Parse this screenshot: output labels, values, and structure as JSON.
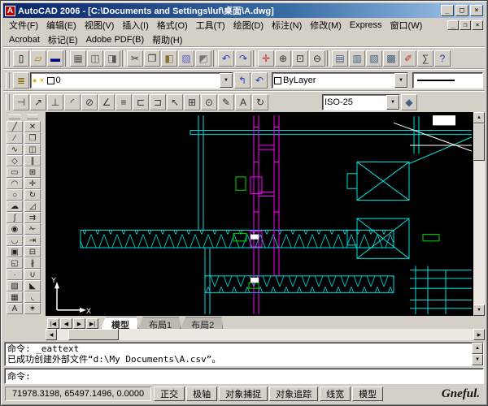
{
  "window": {
    "title": "AutoCAD 2006 - [C:\\Documents and Settings\\luf\\桌面\\A.dwg]",
    "icon_letter": "A"
  },
  "window_controls": {
    "minimize": "_",
    "maximize": "□",
    "restore": "❐",
    "close": "×"
  },
  "glyphs": {
    "combo_arrow": "▼",
    "up": "▲",
    "down": "▼",
    "left": "◀",
    "right": "▶"
  },
  "menubar": {
    "items": [
      "文件(F)",
      "编辑(E)",
      "视图(V)",
      "插入(I)",
      "格式(O)",
      "工具(T)",
      "绘图(D)",
      "标注(N)",
      "修改(M)",
      "Express",
      "窗口(W)"
    ]
  },
  "menubar2": {
    "items": [
      "Acrobat",
      "标记(E)",
      "Adobe PDF(B)",
      "帮助(H)"
    ]
  },
  "toolbar_standard": {
    "icons": [
      {
        "name": "qnew-icon",
        "glyph": "▯",
        "color": "#000000"
      },
      {
        "name": "open-icon",
        "glyph": "▱",
        "color": "#b08000"
      },
      {
        "name": "save-icon",
        "glyph": "▬",
        "color": "#000080"
      },
      {
        "sep": true
      },
      {
        "name": "plot-icon",
        "glyph": "▦",
        "color": "#555555"
      },
      {
        "name": "plot-preview-icon",
        "glyph": "◫",
        "color": "#555555"
      },
      {
        "name": "publish-icon",
        "glyph": "◨",
        "color": "#555555"
      },
      {
        "sep": true
      },
      {
        "name": "cut-icon",
        "glyph": "✂",
        "color": "#333333"
      },
      {
        "name": "copy-icon",
        "glyph": "❐",
        "color": "#333333"
      },
      {
        "name": "paste-icon",
        "glyph": "◧",
        "color": "#8a6d3b"
      },
      {
        "name": "match-properties-icon",
        "glyph": "▨",
        "color": "#6060c0"
      },
      {
        "name": "block-editor-icon",
        "glyph": "◩",
        "color": "#777777"
      },
      {
        "sep": true
      },
      {
        "name": "undo-icon",
        "glyph": "↶",
        "color": "#2040c0"
      },
      {
        "name": "redo-icon",
        "glyph": "↷",
        "color": "#2040c0"
      },
      {
        "sep": true
      },
      {
        "name": "pan-icon",
        "glyph": "✛",
        "color": "#c03030"
      },
      {
        "name": "zoom-realtime-icon",
        "glyph": "⊕",
        "color": "#333333"
      },
      {
        "name": "zoom-window-icon",
        "glyph": "⊡",
        "color": "#333333"
      },
      {
        "name": "zoom-previous-icon",
        "glyph": "⊖",
        "color": "#333333"
      },
      {
        "sep": true
      },
      {
        "name": "properties-icon",
        "glyph": "▤",
        "color": "#406080"
      },
      {
        "name": "designcenter-icon",
        "glyph": "▥",
        "color": "#406080"
      },
      {
        "name": "tool-palettes-icon",
        "glyph": "▧",
        "color": "#406080"
      },
      {
        "name": "sheetset-manager-icon",
        "glyph": "▩",
        "color": "#406080"
      },
      {
        "name": "markup-icon",
        "glyph": "✐",
        "color": "#c03030"
      },
      {
        "name": "quickcalc-icon",
        "glyph": "∑",
        "color": "#333333"
      },
      {
        "name": "help-icon",
        "glyph": "?",
        "color": "#2040c0"
      }
    ]
  },
  "toolbar_layers": {
    "manager_glyph": "≣",
    "bulb_glyph": "●",
    "sun_glyph": "☀",
    "layer_value": "0",
    "make_current_glyph": "↰",
    "layer_previous_glyph": "↶",
    "color_value": "ByLayer"
  },
  "toolbar_dim": {
    "icons": [
      {
        "name": "dim-linear-icon",
        "glyph": "⊣"
      },
      {
        "name": "dim-aligned-icon",
        "glyph": "↗"
      },
      {
        "name": "dim-ordinate-icon",
        "glyph": "⊥"
      },
      {
        "name": "dim-radius-icon",
        "glyph": "◜"
      },
      {
        "name": "dim-diameter-icon",
        "glyph": "⊘"
      },
      {
        "name": "dim-angular-icon",
        "glyph": "∠"
      },
      {
        "name": "quick-dim-icon",
        "glyph": "≡"
      },
      {
        "name": "dim-baseline-icon",
        "glyph": "⊏"
      },
      {
        "name": "dim-continue-icon",
        "glyph": "⊐"
      },
      {
        "name": "quick-leader-icon",
        "glyph": "↖"
      },
      {
        "name": "tolerance-icon",
        "glyph": "⊞"
      },
      {
        "name": "center-mark-icon",
        "glyph": "⊙"
      },
      {
        "name": "dim-edit-icon",
        "glyph": "✎"
      },
      {
        "name": "dim-text-edit-icon",
        "glyph": "A"
      },
      {
        "name": "dim-update-icon",
        "glyph": "↻"
      }
    ],
    "style_value": "ISO-25",
    "style_icon_glyph": "◆"
  },
  "draw_toolbar": {
    "icons": [
      {
        "name": "line-icon",
        "glyph": "╱"
      },
      {
        "name": "construction-line-icon",
        "glyph": "∕"
      },
      {
        "name": "polyline-icon",
        "glyph": "∿"
      },
      {
        "name": "polygon-icon",
        "glyph": "◇"
      },
      {
        "name": "rectangle-icon",
        "glyph": "▭"
      },
      {
        "name": "arc-icon",
        "glyph": "◠"
      },
      {
        "name": "circle-icon",
        "glyph": "○"
      },
      {
        "name": "revcloud-icon",
        "glyph": "☁"
      },
      {
        "name": "spline-icon",
        "glyph": "∫"
      },
      {
        "name": "ellipse-icon",
        "glyph": "◉"
      },
      {
        "name": "ellipse-arc-icon",
        "glyph": "◡"
      },
      {
        "name": "insert-block-icon",
        "glyph": "▣"
      },
      {
        "name": "make-block-icon",
        "glyph": "◱"
      },
      {
        "name": "point-icon",
        "glyph": "∙"
      },
      {
        "name": "hatch-icon",
        "glyph": "▨"
      },
      {
        "name": "table-icon",
        "glyph": "▦"
      },
      {
        "name": "mtext-icon",
        "glyph": "A"
      }
    ]
  },
  "modify_toolbar": {
    "icons": [
      {
        "name": "erase-icon",
        "glyph": "✕"
      },
      {
        "name": "copy-object-icon",
        "glyph": "❐"
      },
      {
        "name": "mirror-icon",
        "glyph": "◫"
      },
      {
        "name": "offset-icon",
        "glyph": "∥"
      },
      {
        "name": "array-icon",
        "glyph": "⊞"
      },
      {
        "name": "move-icon",
        "glyph": "✛"
      },
      {
        "name": "rotate-icon",
        "glyph": "↻"
      },
      {
        "name": "scale-icon",
        "glyph": "◿"
      },
      {
        "name": "stretch-icon",
        "glyph": "⇉"
      },
      {
        "name": "trim-icon",
        "glyph": "✁"
      },
      {
        "name": "extend-icon",
        "glyph": "⇥"
      },
      {
        "name": "break-at-point-icon",
        "glyph": "⊟"
      },
      {
        "name": "break-icon",
        "glyph": "∦"
      },
      {
        "name": "join-icon",
        "glyph": "∪"
      },
      {
        "name": "chamfer-icon",
        "glyph": "◣"
      },
      {
        "name": "fillet-icon",
        "glyph": "◟"
      },
      {
        "name": "explode-icon",
        "glyph": "✶"
      }
    ]
  },
  "tabs": {
    "nav": [
      "|◀",
      "◀",
      "▶",
      "▶|"
    ],
    "items": [
      {
        "label": "模型",
        "active": true
      },
      {
        "label": "布局1",
        "active": false
      },
      {
        "label": "布局2",
        "active": false
      }
    ]
  },
  "command": {
    "history": [
      "命令:  _eattext",
      "已成功创建外部文件“d:\\My Documents\\A.csv”。"
    ],
    "prompt": "命令:"
  },
  "statusbar": {
    "coords": "71978.3198, 65497.1496, 0.0000",
    "toggles": [
      "正交",
      "极轴",
      "对象捕捉",
      "对象追踪",
      "线宽",
      "模型"
    ]
  },
  "watermark": "Gneful.",
  "colors": {
    "cyan": "#00e0e0",
    "magenta": "#ff00ff",
    "green": "#00d800",
    "canvas": "#000000",
    "titlebar_start": "#0a246a",
    "titlebar_end": "#a6caf0"
  }
}
